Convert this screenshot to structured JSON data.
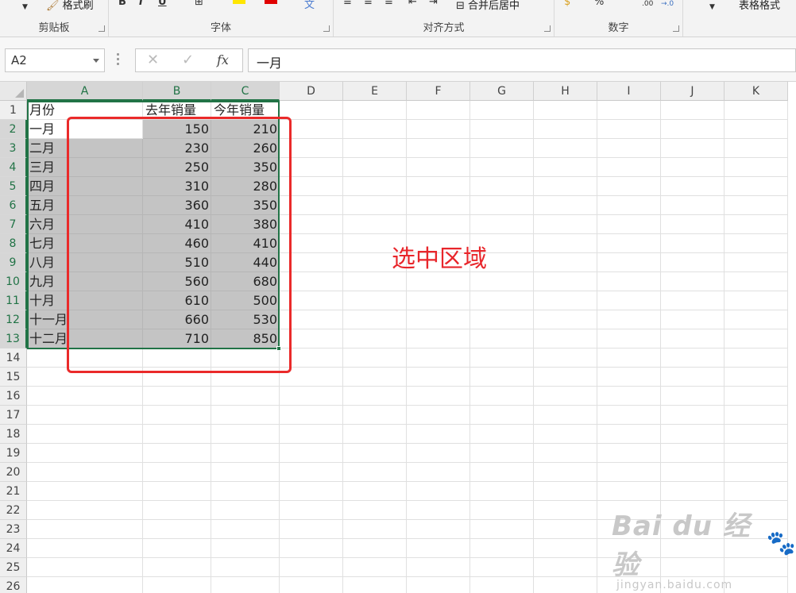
{
  "ribbon": {
    "format_painter": "格式刷",
    "table_format": "表格格式",
    "merge_center": "合并后居中",
    "groups": [
      "剪贴板",
      "字体",
      "对齐方式",
      "数字"
    ]
  },
  "formula_bar": {
    "name_box": "A2",
    "cancel_icon": "✕",
    "confirm_icon": "✓",
    "fx_label": "fx",
    "formula_value": "一月"
  },
  "columns": [
    "A",
    "B",
    "C",
    "D",
    "E",
    "F",
    "G",
    "H",
    "I",
    "J",
    "K"
  ],
  "row_numbers": [
    "1",
    "2",
    "3",
    "4",
    "5",
    "6",
    "7",
    "8",
    "9",
    "10",
    "11",
    "12",
    "13",
    "14",
    "15",
    "16",
    "17",
    "18",
    "19",
    "20",
    "21",
    "22",
    "23",
    "24",
    "25",
    "26"
  ],
  "table": {
    "headers": [
      "月份",
      "去年销量",
      "今年销量"
    ],
    "rows": [
      [
        "一月",
        "150",
        "210"
      ],
      [
        "二月",
        "230",
        "260"
      ],
      [
        "三月",
        "250",
        "350"
      ],
      [
        "四月",
        "310",
        "280"
      ],
      [
        "五月",
        "360",
        "350"
      ],
      [
        "六月",
        "410",
        "380"
      ],
      [
        "七月",
        "460",
        "410"
      ],
      [
        "八月",
        "510",
        "440"
      ],
      [
        "九月",
        "560",
        "680"
      ],
      [
        "十月",
        "610",
        "500"
      ],
      [
        "十一月",
        "660",
        "530"
      ],
      [
        "十二月",
        "710",
        "850"
      ]
    ]
  },
  "annotation": {
    "label": "选中区域",
    "color": "#e8262b"
  },
  "watermark": {
    "brand": "Bai du 经验",
    "url": "jingyan.baidu.com"
  },
  "colors": {
    "accent": "#217346",
    "selection_fill": "#c4c4c4"
  }
}
